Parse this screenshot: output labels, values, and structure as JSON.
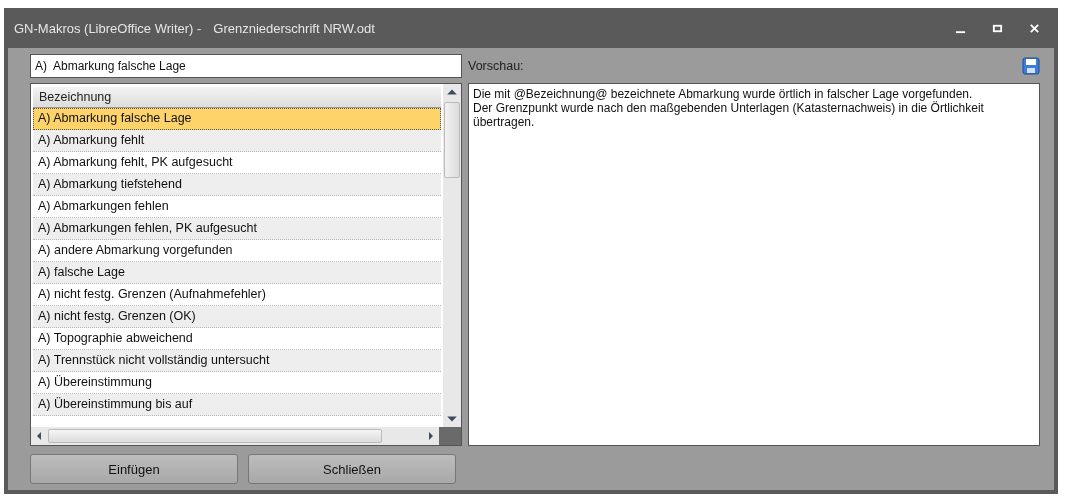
{
  "window": {
    "title": "GN-Makros (LibreOffice Writer) -",
    "document": "Grenzniederschrift NRW.odt"
  },
  "search_field": {
    "value": "A)  Abmarkung falsche Lage"
  },
  "preview": {
    "label": "Vorschau:",
    "paragraphs": [
      "Die mit @Bezeichnung@ bezeichnete Abmarkung wurde örtlich in falscher Lage vorgefunden.",
      "Der Grenzpunkt wurde nach den maßgebenden Unterlagen (Katasternachweis) in die Örtlichkeit übertragen."
    ]
  },
  "list": {
    "column": "Bezeichnung",
    "rows": [
      {
        "text": "A)  Abmarkung falsche Lage",
        "selected": true
      },
      {
        "text": "A)  Abmarkung fehlt",
        "selected": false
      },
      {
        "text": "A)  Abmarkung fehlt, PK aufgesucht",
        "selected": false
      },
      {
        "text": "A)  Abmarkung tiefstehend",
        "selected": false
      },
      {
        "text": "A)  Abmarkungen fehlen",
        "selected": false
      },
      {
        "text": "A)  Abmarkungen fehlen, PK aufgesucht",
        "selected": false
      },
      {
        "text": "A)  andere Abmarkung vorgefunden",
        "selected": false
      },
      {
        "text": "A)  falsche Lage",
        "selected": false
      },
      {
        "text": "A)  nicht festg. Grenzen (Aufnahmefehler)",
        "selected": false
      },
      {
        "text": "A)  nicht festg. Grenzen (OK)",
        "selected": false
      },
      {
        "text": "A)  Topographie abweichend",
        "selected": false
      },
      {
        "text": "A)  Trennstück nicht vollständig untersucht",
        "selected": false
      },
      {
        "text": "A)  Übereinstimmung",
        "selected": false
      },
      {
        "text": "A)  Übereinstimmung bis auf",
        "selected": false
      }
    ]
  },
  "buttons": [
    "Einfügen",
    "Schließen"
  ]
}
